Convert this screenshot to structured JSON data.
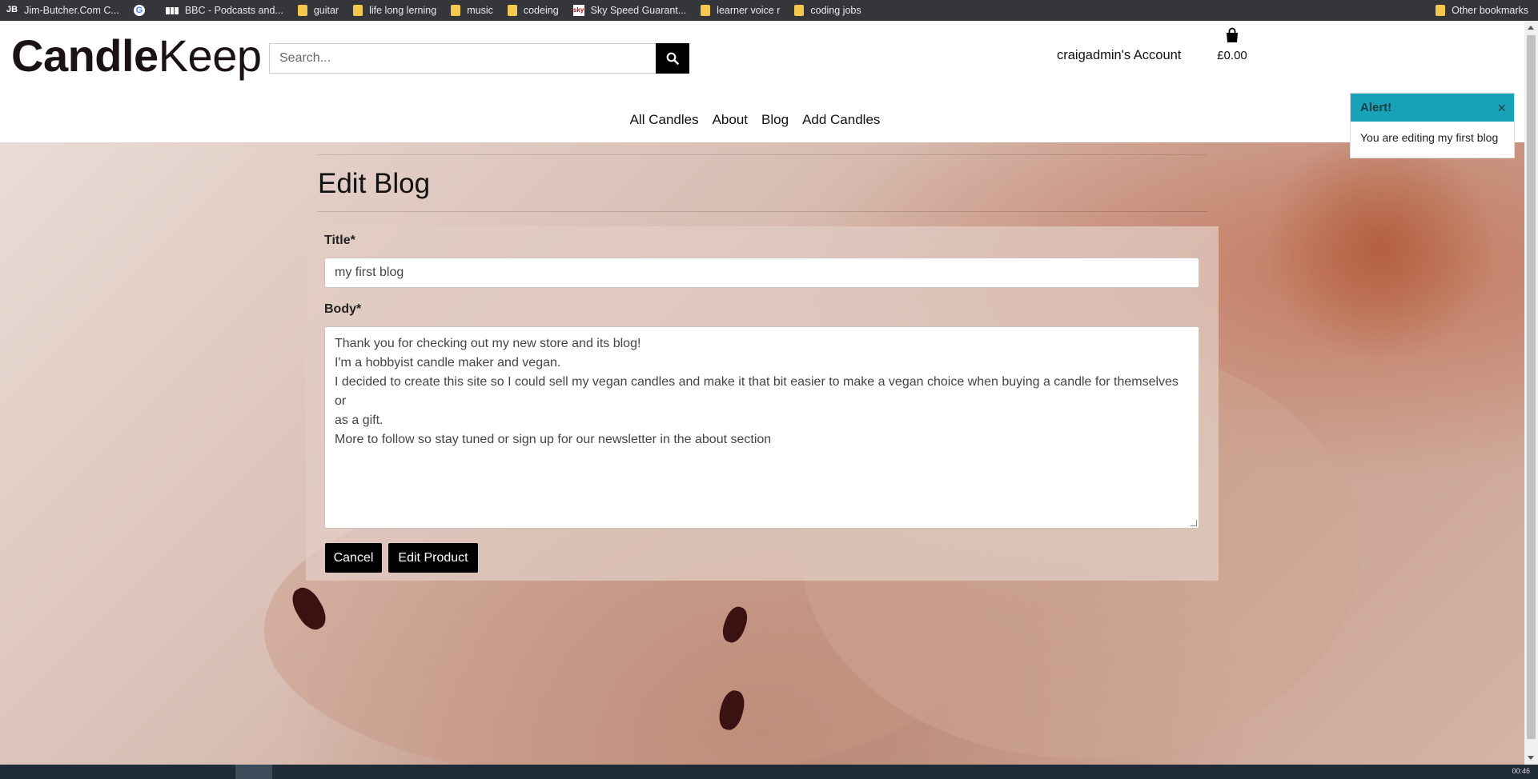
{
  "bookmarks": {
    "items": [
      {
        "label": "Jim-Butcher.Com C...",
        "icon": "jb-favicon"
      },
      {
        "label": "",
        "icon": "google-icon"
      },
      {
        "label": "BBC - Podcasts and...",
        "icon": "bbc-favicon"
      },
      {
        "label": "guitar",
        "icon": "folder-icon"
      },
      {
        "label": "life long lerning",
        "icon": "folder-icon"
      },
      {
        "label": "music",
        "icon": "folder-icon"
      },
      {
        "label": "codeing",
        "icon": "folder-icon"
      },
      {
        "label": "Sky Speed Guarant...",
        "icon": "sky-favicon"
      },
      {
        "label": "learner voice r",
        "icon": "folder-icon"
      },
      {
        "label": "coding jobs",
        "icon": "folder-icon"
      }
    ],
    "other": "Other bookmarks"
  },
  "header": {
    "logo_bold": "Candle",
    "logo_light": "Keep",
    "search_placeholder": "Search...",
    "account": "craigadmin's Account",
    "bag_total": "£0.00"
  },
  "nav": {
    "items": [
      "All Candles",
      "About",
      "Blog",
      "Add Candles"
    ]
  },
  "form": {
    "page_title": "Edit Blog",
    "title_label": "Title*",
    "title_value": "my first blog",
    "body_label": "Body*",
    "body_lines": [
      "Thank you for checking out my new store and its blog!",
      "I'm a hobbyist candle maker and vegan.",
      "I decided to create this site so I could sell my vegan candles and make it that bit easier to make a vegan choice when buying a candle for themselves or",
      "as a gift.",
      "More to follow so stay tuned or sign up for our newsletter in the about section"
    ],
    "cancel_label": "Cancel",
    "submit_label": "Edit Product"
  },
  "alert": {
    "title": "Alert!",
    "message": "You are editing my first blog"
  },
  "taskbar": {
    "clock": "00:46"
  },
  "colors": {
    "alert_header": "#17a2b8",
    "button_bg": "#000000",
    "bookmarks_bar": "#35363a"
  }
}
